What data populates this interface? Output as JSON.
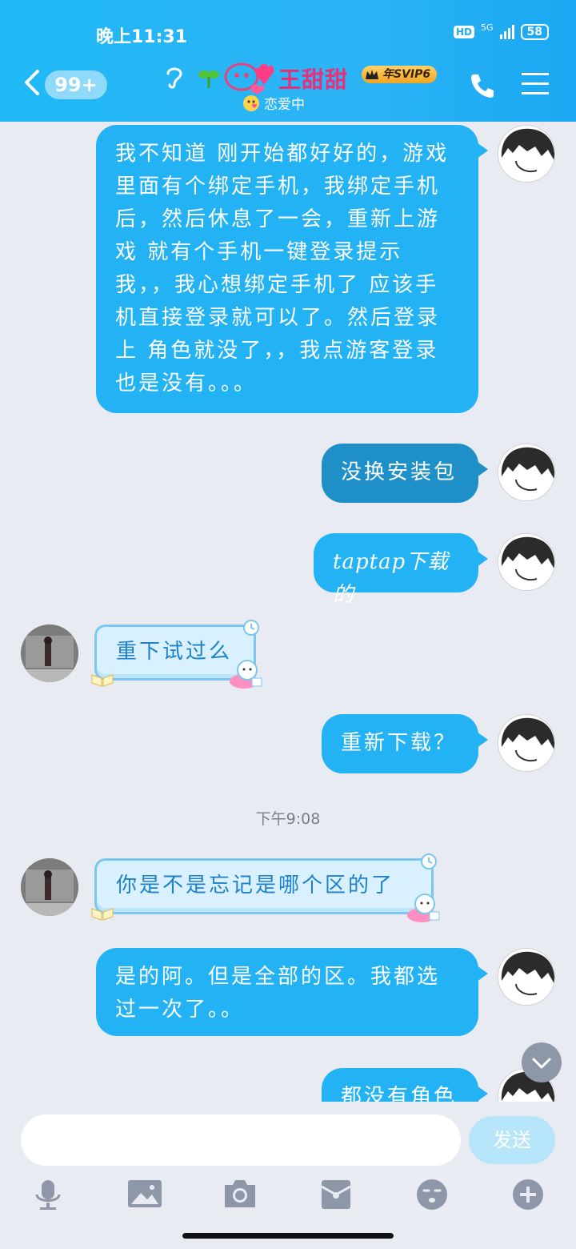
{
  "status_bar": {
    "time": "晚上11:31",
    "hd": "HD",
    "network": "5G",
    "battery": "58"
  },
  "header": {
    "unread_count": "99+",
    "contact_name": "王甜甜",
    "vip_badge": "年SVIP6",
    "contact_status": "恋爱中"
  },
  "messages": [
    {
      "side": "right",
      "text": "我不知道 刚开始都好好的，游戏里面有个绑定手机，我绑定手机后，然后休息了一会，重新上游戏 就有个手机一键登录提示我，，我心想绑定手机了 应该手机直接登录就可以了。然后登录上 角色就没了，，我点游客登录 也是没有。。。"
    },
    {
      "side": "right",
      "text": "没换安装包"
    },
    {
      "side": "right",
      "text": "taptap下载的"
    },
    {
      "side": "left",
      "text": "重下试过么"
    },
    {
      "side": "right",
      "text": "重新下载？"
    },
    {
      "side": "left",
      "text": "你是不是忘记是哪个区的了"
    },
    {
      "side": "right",
      "text": "是的阿。但是全部的区。我都选过一次了。。"
    },
    {
      "side": "right",
      "text": "都没有角色"
    }
  ],
  "time_separator": "下午9:08",
  "input": {
    "placeholder": "",
    "send_label": "发送"
  },
  "toolbar_icons": [
    "microphone-icon",
    "image-icon",
    "camera-icon",
    "red-packet-icon",
    "emoji-icon",
    "plus-icon"
  ],
  "colors": {
    "header": "#1fb8f5",
    "bubble": "#23b3f5",
    "bubble_selected": "#1f8fc8",
    "background": "#e9ebf2",
    "send": "#b7e6fb"
  }
}
